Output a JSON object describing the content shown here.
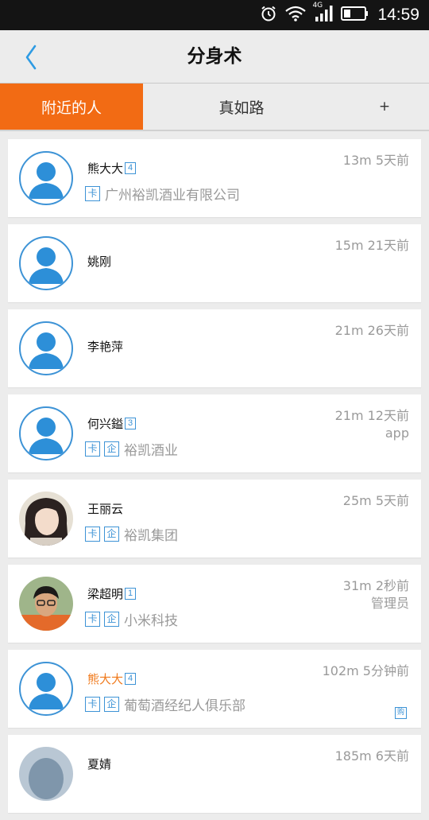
{
  "status_bar": {
    "network": "4G",
    "time": "14:59"
  },
  "header": {
    "title": "分身术"
  },
  "tabs": [
    {
      "label": "附近的人",
      "active": true
    },
    {
      "label": "真如路",
      "active": false
    },
    {
      "label": "+",
      "active": false
    }
  ],
  "colors": {
    "accent": "#f26b14",
    "link_blue": "#3d93d6",
    "orange_name": "#f07b1e"
  },
  "contacts": [
    {
      "name": "熊大大",
      "level": "4",
      "badges": [
        "卡"
      ],
      "company": "广州裕凯酒业有限公司",
      "distance_time": "13m 5天前",
      "extra": "",
      "avatar": "default"
    },
    {
      "name": "姚刚",
      "level": "",
      "badges": [],
      "company": "",
      "distance_time": "15m 21天前",
      "extra": "",
      "avatar": "default"
    },
    {
      "name": "李艳萍",
      "level": "",
      "badges": [],
      "company": "",
      "distance_time": "21m 26天前",
      "extra": "",
      "avatar": "default"
    },
    {
      "name": "何兴鎰",
      "level": "3",
      "badges": [
        "卡",
        "企"
      ],
      "company": "裕凯酒业",
      "distance_time": "21m 12天前",
      "extra": "app",
      "avatar": "default"
    },
    {
      "name": "王丽云",
      "level": "",
      "badges": [
        "卡",
        "企"
      ],
      "company": "裕凯集团",
      "distance_time": "25m 5天前",
      "extra": "",
      "avatar": "photo-woman"
    },
    {
      "name": "梁超明",
      "level": "1",
      "badges": [
        "卡",
        "企"
      ],
      "company": "小米科技",
      "distance_time": "31m 2秒前",
      "extra": "管理员",
      "avatar": "photo-boy"
    },
    {
      "name": "熊大大",
      "level": "4",
      "badges": [
        "卡",
        "企"
      ],
      "company": "葡萄酒经纪人俱乐部",
      "distance_time": "102m 5分钟前",
      "extra": "",
      "corner_badge": "购",
      "avatar": "default",
      "name_color": "orange"
    },
    {
      "name": "夏婧",
      "level": "",
      "badges": [],
      "company": "",
      "distance_time": "185m 6天前",
      "extra": "",
      "avatar": "photo-partial"
    }
  ]
}
